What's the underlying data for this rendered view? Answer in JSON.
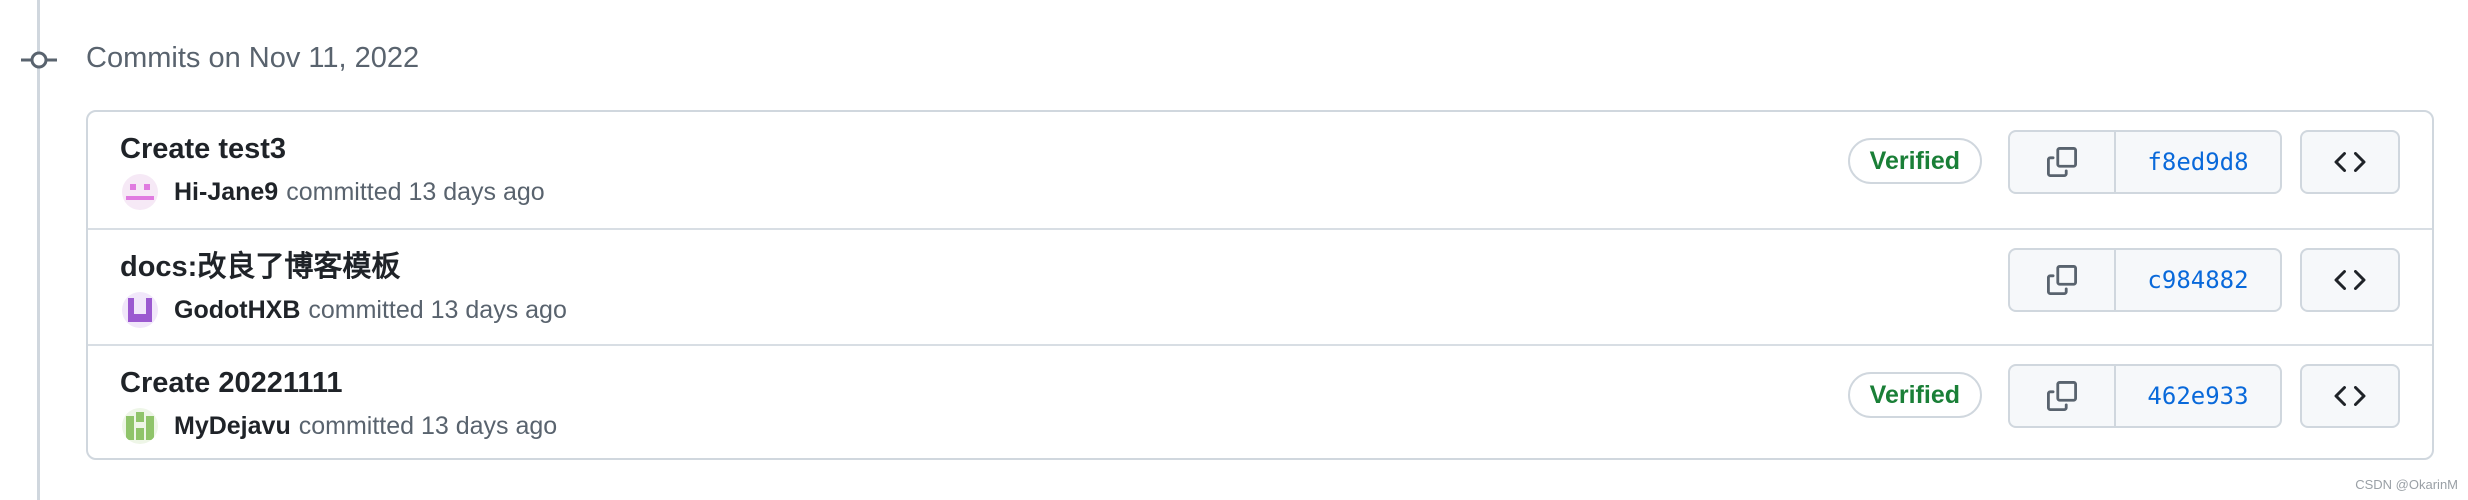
{
  "group": {
    "date_label": "Commits on Nov 11, 2022"
  },
  "commits": [
    {
      "title": "Create test3",
      "author": "Hi-Jane9",
      "meta": "committed 13 days ago",
      "verified": "Verified",
      "sha": "f8ed9d8",
      "avatar_color": "#e07be0"
    },
    {
      "title": "docs:改良了博客模板",
      "author": "GodotHXB",
      "meta": "committed 13 days ago",
      "verified": null,
      "sha": "c984882",
      "avatar_color": "#9b59d0"
    },
    {
      "title": "Create 20221111",
      "author": "MyDejavu",
      "meta": "committed 13 days ago",
      "verified": "Verified",
      "sha": "462e933",
      "avatar_color": "#8fc46a"
    }
  ],
  "icons": {
    "commit": "git-commit-icon",
    "copy": "copy-icon",
    "browse": "code-icon"
  },
  "colors": {
    "verified": "#1a7f37",
    "sha_link": "#0969da",
    "border": "#d0d7de"
  },
  "watermark": "CSDN @OkarinM"
}
